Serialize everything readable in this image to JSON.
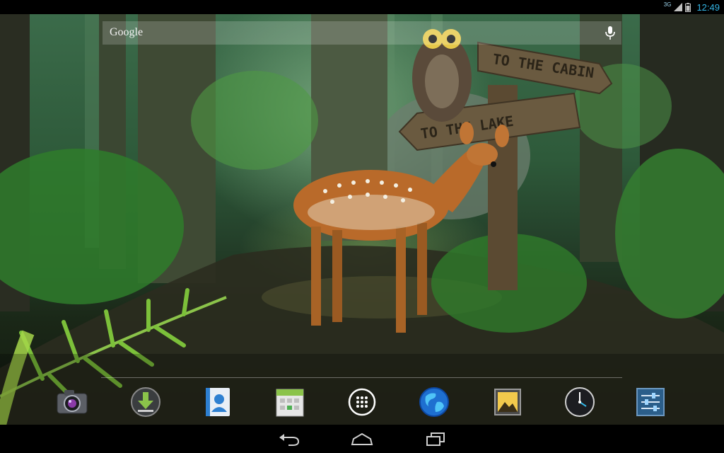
{
  "status_bar": {
    "network": "3G",
    "time": "12:49",
    "icons": [
      "signal-icon",
      "battery-icon"
    ]
  },
  "search": {
    "label": "Google",
    "icons": [
      "mic-icon"
    ]
  },
  "wallpaper": {
    "signs": [
      "TO THE CABIN",
      "TO THE LAKE"
    ]
  },
  "dock": {
    "apps": [
      "camera-icon",
      "downloads-icon",
      "contacts-icon",
      "calendar-icon",
      "all-apps-icon",
      "browser-icon",
      "gallery-icon",
      "clock-icon",
      "settings-icon"
    ]
  },
  "nav": {
    "buttons": [
      "back-icon",
      "home-icon",
      "recents-icon"
    ]
  },
  "colors": {
    "accent": "#33b5e5",
    "status_bar": "#000000"
  }
}
